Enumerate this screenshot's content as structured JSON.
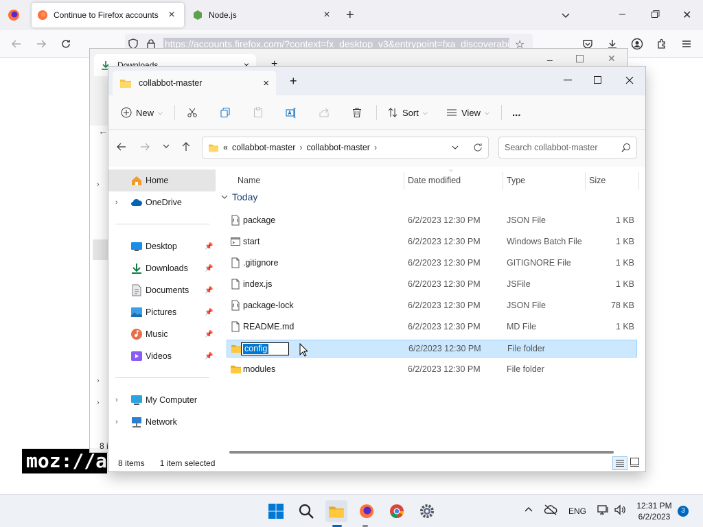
{
  "browser": {
    "tabs": [
      {
        "label": "Continue to Firefox accounts"
      },
      {
        "label": "Node.js"
      }
    ],
    "url": "https://accounts.firefox.com/?context=fx_desktop_v3&entrypoint=fxa_discoverabil",
    "page_logo": "moz://a"
  },
  "back_explorer": {
    "tab_label": "Downloads",
    "status_fragment": "8 i"
  },
  "explorer": {
    "tab_label": "collabbot-master",
    "toolbar": {
      "new_label": "New",
      "sort_label": "Sort",
      "view_label": "View",
      "more_label": "..."
    },
    "breadcrumb": {
      "overflow": "«",
      "parts": [
        "collabbot-master",
        "collabbot-master"
      ]
    },
    "search_placeholder": "Search collabbot-master",
    "nav": {
      "home": "Home",
      "onedrive": "OneDrive",
      "quick_access": [
        {
          "label": "Desktop",
          "icon": "desktop-icon"
        },
        {
          "label": "Downloads",
          "icon": "download-icon"
        },
        {
          "label": "Documents",
          "icon": "documents-icon"
        },
        {
          "label": "Pictures",
          "icon": "pictures-icon"
        },
        {
          "label": "Music",
          "icon": "music-icon"
        },
        {
          "label": "Videos",
          "icon": "videos-icon"
        }
      ],
      "my_computer": "My Computer",
      "network": "Network"
    },
    "columns": {
      "name": "Name",
      "date": "Date modified",
      "type": "Type",
      "size": "Size"
    },
    "group_label": "Today",
    "files": [
      {
        "name": "package",
        "date": "6/2/2023 12:30 PM",
        "type": "JSON File",
        "size": "1 KB",
        "icon": "json-file-icon"
      },
      {
        "name": "start",
        "date": "6/2/2023 12:30 PM",
        "type": "Windows Batch File",
        "size": "1 KB",
        "icon": "batch-file-icon"
      },
      {
        "name": ".gitignore",
        "date": "6/2/2023 12:30 PM",
        "type": "GITIGNORE File",
        "size": "1 KB",
        "icon": "file-icon"
      },
      {
        "name": "index.js",
        "date": "6/2/2023 12:30 PM",
        "type": "JSFile",
        "size": "1 KB",
        "icon": "file-icon"
      },
      {
        "name": "package-lock",
        "date": "6/2/2023 12:30 PM",
        "type": "JSON File",
        "size": "78 KB",
        "icon": "json-file-icon"
      },
      {
        "name": "README.md",
        "date": "6/2/2023 12:30 PM",
        "type": "MD File",
        "size": "1 KB",
        "icon": "file-icon"
      },
      {
        "name": "config",
        "date": "6/2/2023 12:30 PM",
        "type": "File folder",
        "size": "",
        "icon": "folder-icon",
        "selected": true,
        "renaming": true
      },
      {
        "name": "modules",
        "date": "6/2/2023 12:30 PM",
        "type": "File folder",
        "size": "",
        "icon": "folder-icon"
      }
    ],
    "status": {
      "items": "8 items",
      "selected": "1 item selected"
    }
  },
  "taskbar": {
    "language": "ENG",
    "time": "12:31 PM",
    "date": "6/2/2023",
    "notification_count": "3"
  },
  "colors": {
    "accent": "#0078d4",
    "selection": "#cce8ff",
    "folder": "#f4c042"
  }
}
